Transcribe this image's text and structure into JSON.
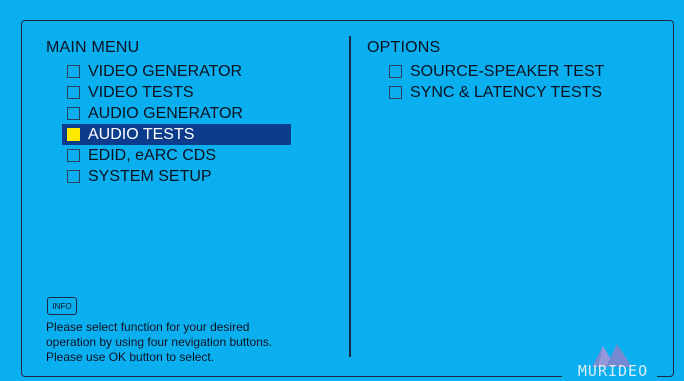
{
  "main_menu": {
    "title": "MAIN MENU",
    "items": [
      {
        "label": "VIDEO GENERATOR",
        "selected": false
      },
      {
        "label": "VIDEO TESTS",
        "selected": false
      },
      {
        "label": "AUDIO GENERATOR",
        "selected": false
      },
      {
        "label": "AUDIO TESTS",
        "selected": true
      },
      {
        "label": "EDID, eARC CDS",
        "selected": false
      },
      {
        "label": "SYSTEM SETUP",
        "selected": false
      }
    ]
  },
  "options": {
    "title": "OPTIONS",
    "items": [
      {
        "label": "SOURCE-SPEAKER TEST",
        "selected": false
      },
      {
        "label": "SYNC & LATENCY TESTS",
        "selected": false
      }
    ]
  },
  "info": {
    "badge": "INFO",
    "help_lines": [
      "Please select function for your desired",
      "operation by using four nevigation buttons.",
      "Please use OK button to select."
    ]
  },
  "brand": {
    "name": "MURIDEO",
    "icon": "mountain-logo-icon"
  },
  "colors": {
    "background": "#0aaff0",
    "selection": "#0d3c8c",
    "selected_checkbox": "#ffea00",
    "frame": "#1a2a44"
  }
}
